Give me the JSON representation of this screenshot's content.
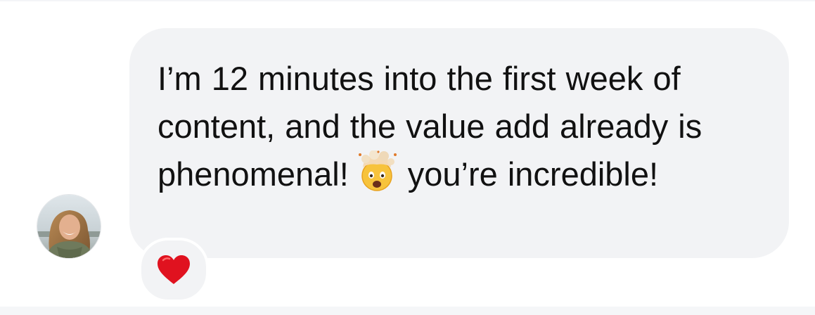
{
  "message": {
    "text_part1": "I’m 12 minutes into the first week of content, and the value add already is phenomenal!",
    "emoji": "exploding-head-emoji",
    "text_part2": "you’re incredible!"
  },
  "reaction": {
    "icon": "red-heart-icon",
    "color": "#e0121f"
  },
  "colors": {
    "bubble_background": "#f2f3f5",
    "text": "#111111",
    "page_background": "#ffffff"
  }
}
